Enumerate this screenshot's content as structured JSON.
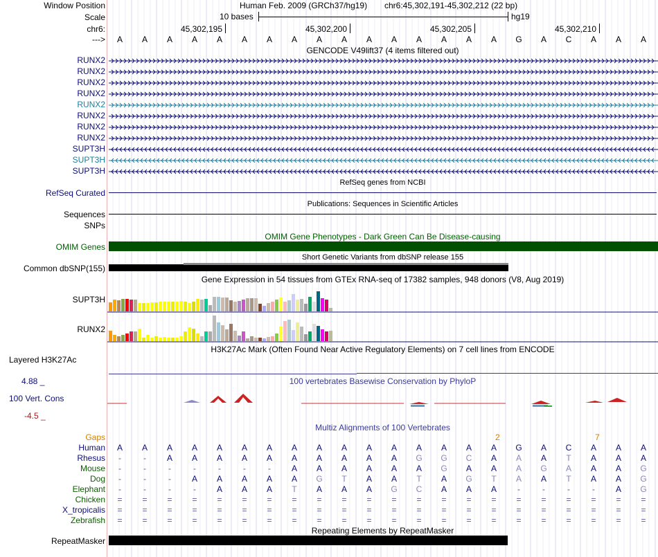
{
  "header": {
    "window_position_label": "Window Position",
    "assembly_text": "Human Feb. 2009 (GRCh37/hg19)",
    "position_text": "chr6:45,302,191-45,302,212 (22 bp)",
    "scale_label": "Scale",
    "scale_text": "10 bases",
    "scale_db": "hg19",
    "chrom_label": "chr6:",
    "arrow_label": "--->",
    "ticks": [
      "45,302,195",
      "45,302,200",
      "45,302,205",
      "45,302,210"
    ],
    "bases": [
      "A",
      "A",
      "A",
      "A",
      "A",
      "A",
      "A",
      "A",
      "A",
      "A",
      "A",
      "A",
      "A",
      "A",
      "A",
      "A",
      "G",
      "A",
      "C",
      "A",
      "A",
      "A"
    ]
  },
  "gencode": {
    "title": "GENCODE V49lift37 (4 items filtered out)",
    "items": [
      {
        "name": "RUNX2",
        "dir": "+",
        "color": "#0c0c78"
      },
      {
        "name": "RUNX2",
        "dir": "+",
        "color": "#0c0c78"
      },
      {
        "name": "RUNX2",
        "dir": "+",
        "color": "#0c0c78"
      },
      {
        "name": "RUNX2",
        "dir": "+",
        "color": "#0c0c78"
      },
      {
        "name": "RUNX2",
        "dir": "+",
        "color": "#1a7fa0"
      },
      {
        "name": "RUNX2",
        "dir": "+",
        "color": "#0c0c78"
      },
      {
        "name": "RUNX2",
        "dir": "+",
        "color": "#0c0c78"
      },
      {
        "name": "RUNX2",
        "dir": "+",
        "color": "#0c0c78"
      },
      {
        "name": "SUPT3H",
        "dir": "-",
        "color": "#0c0c78"
      },
      {
        "name": "SUPT3H",
        "dir": "-",
        "color": "#1a7fa0"
      },
      {
        "name": "SUPT3H",
        "dir": "-",
        "color": "#0c0c78"
      }
    ]
  },
  "refseq": {
    "label": "RefSeq Curated",
    "title": "RefSeq genes from NCBI"
  },
  "pubs": {
    "label": "Sequences",
    "title": "Publications: Sequences in Scientific Articles"
  },
  "snps_label": "SNPs",
  "omim": {
    "label": "OMIM Genes",
    "title": "OMIM Gene Phenotypes - Dark Green Can Be Disease-causing",
    "color": "#005000"
  },
  "dbsnp": {
    "label": "Common dbSNP(155)",
    "title": "Short Genetic Variants from dbSNP release 155"
  },
  "gtex": {
    "title": "Gene Expression in 54 tissues from GTEx RNA-seq of 17382 samples, 948 donors (V8, Aug 2019)",
    "genes": [
      {
        "name": "SUPT3H",
        "values": [
          0.42,
          0.55,
          0.52,
          0.6,
          0.6,
          0.55,
          0.58,
          0.4,
          0.4,
          0.4,
          0.42,
          0.42,
          0.45,
          0.48,
          0.48,
          0.48,
          0.45,
          0.5,
          0.45,
          0.4,
          0.48,
          0.6,
          0.55,
          0.6,
          0.3,
          0.7,
          0.7,
          0.68,
          0.68,
          0.52,
          0.48,
          0.5,
          0.55,
          0.62,
          0.62,
          0.62,
          0.35,
          0.25,
          0.4,
          0.48,
          0.55,
          0.65,
          0.48,
          0.52,
          0.82,
          0.55,
          0.6,
          0.38,
          0.7,
          0.45,
          0.95,
          0.62,
          0.58,
          0.15
        ]
      },
      {
        "name": "RUNX2",
        "values": [
          0.38,
          0.22,
          0.18,
          0.22,
          0.28,
          0.36,
          0.36,
          0.45,
          0.12,
          0.22,
          0.12,
          0.18,
          0.12,
          0.15,
          0.12,
          0.12,
          0.12,
          0.18,
          0.36,
          0.5,
          0.45,
          0.28,
          0.18,
          0.35,
          0.35,
          0.92,
          0.68,
          0.58,
          0.42,
          0.62,
          0.38,
          0.2,
          0.36,
          0.1,
          0.18,
          0.12,
          0.12,
          0.1,
          0.15,
          0.18,
          0.28,
          0.52,
          0.72,
          0.78,
          0.4,
          0.68,
          0.52,
          0.25,
          0.36,
          0.62,
          0.55,
          0.42,
          0.36,
          0.38
        ]
      }
    ],
    "colors": [
      "#ff9900",
      "#ffaa00",
      "#bb8855",
      "#88aa44",
      "#ff0000",
      "#dd2255",
      "#bbaa88",
      "#ffff00",
      "#eeee00",
      "#ffff00",
      "#ffff00",
      "#eeee00",
      "#ffff00",
      "#ffff00",
      "#ffff00",
      "#eeee00",
      "#ffff00",
      "#ffff00",
      "#eeee00",
      "#ffff00",
      "#dddd00",
      "#ffee00",
      "#bbbbbb",
      "#00cc99",
      "#aaaaaa",
      "#bbbbbb",
      "#99ccdd",
      "#ccbbaa",
      "#bbaa99",
      "#997766",
      "#ccbbaa",
      "#aa88cc",
      "#cc55cc",
      "#bbaa99",
      "#aa9988",
      "#ccbbaa",
      "#884422",
      "#aaaaff",
      "#ccbbaa",
      "#ffaaaa",
      "#88cc44",
      "#ffff33",
      "#ffbbbb",
      "#aacccc",
      "#ccccff",
      "#eeee99",
      "#bbbbbb",
      "#999999",
      "#00aa66",
      "#dddddd",
      "#006688",
      "#ff00ff",
      "#dd0066",
      "#bbbb99"
    ]
  },
  "h3k27ac": {
    "label": "Layered H3K27Ac",
    "title": "H3K27Ac Mark (Often Found Near Active Regulatory Elements) on 7 cell lines from ENCODE"
  },
  "phylop": {
    "label": "100 Vert. Cons",
    "title": "100 vertebrates Basewise Conservation by PhyloP",
    "max_label": "4.88 _",
    "min_label": "-4.5 _"
  },
  "multiz": {
    "title": "Multiz Alignments of 100 Vertebrates",
    "gaps_label": "Gaps",
    "gap_marks": [
      {
        "col": 16,
        "text": "2"
      },
      {
        "col": 20,
        "text": "7"
      }
    ],
    "species": [
      {
        "name": "Human",
        "color": "#0c0c78",
        "seq": [
          "A",
          "A",
          "A",
          "A",
          "A",
          "A",
          "A",
          "A",
          "A",
          "A",
          "A",
          "A",
          "A",
          "A",
          "A",
          "A",
          "G",
          "A",
          "C",
          "A",
          "A",
          "A"
        ]
      },
      {
        "name": "Rhesus",
        "color": "#0c0c78",
        "seq": [
          "-",
          "-",
          "A",
          "A",
          "A",
          "A",
          "A",
          "A",
          "A",
          "A",
          "A",
          "A",
          "G",
          "G",
          "C",
          "A",
          "A",
          "A",
          "T",
          "A",
          "A",
          "A"
        ]
      },
      {
        "name": "Mouse",
        "color": "#0c5c00",
        "seq": [
          "-",
          "-",
          "-",
          "-",
          "-",
          "-",
          "-",
          "A",
          "A",
          "A",
          "A",
          "A",
          "A",
          "G",
          "A",
          "A",
          "A",
          "G",
          "A",
          "A",
          "A",
          "G"
        ]
      },
      {
        "name": "Dog",
        "color": "#0c5c00",
        "seq": [
          "-",
          "-",
          "-",
          "A",
          "A",
          "A",
          "A",
          "A",
          "G",
          "T",
          "A",
          "A",
          "T",
          "A",
          "G",
          "T",
          "A",
          "A",
          "T",
          "A",
          "A",
          "G"
        ]
      },
      {
        "name": "Elephant",
        "color": "#0c5c00",
        "seq": [
          "-",
          "-",
          "-",
          "-",
          "A",
          "A",
          "A",
          "T",
          "A",
          "A",
          "A",
          "G",
          "C",
          "A",
          "A",
          "A",
          "-",
          "-",
          "-",
          "-",
          "A",
          "G"
        ]
      },
      {
        "name": "Chicken",
        "color": "#0c5c00",
        "seq": [
          "=",
          "=",
          "=",
          "=",
          "=",
          "=",
          "=",
          "=",
          "=",
          "=",
          "=",
          "=",
          "=",
          "=",
          "=",
          "=",
          "=",
          "=",
          "=",
          "=",
          "=",
          "="
        ]
      },
      {
        "name": "X_tropicalis",
        "color": "#0c0c78",
        "seq": [
          "=",
          "=",
          "=",
          "=",
          "=",
          "=",
          "=",
          "=",
          "=",
          "=",
          "=",
          "=",
          "=",
          "=",
          "=",
          "=",
          "=",
          "=",
          "=",
          "=",
          "=",
          "="
        ]
      },
      {
        "name": "Zebrafish",
        "color": "#0c5c00",
        "seq": [
          "=",
          "=",
          "=",
          "=",
          "=",
          "=",
          "=",
          "=",
          "=",
          "=",
          "=",
          "=",
          "=",
          "=",
          "=",
          "=",
          "=",
          "=",
          "=",
          "=",
          "=",
          "="
        ]
      }
    ]
  },
  "repeatmasker": {
    "label": "RepeatMasker",
    "title": "Repeating Elements by RepeatMasker"
  }
}
